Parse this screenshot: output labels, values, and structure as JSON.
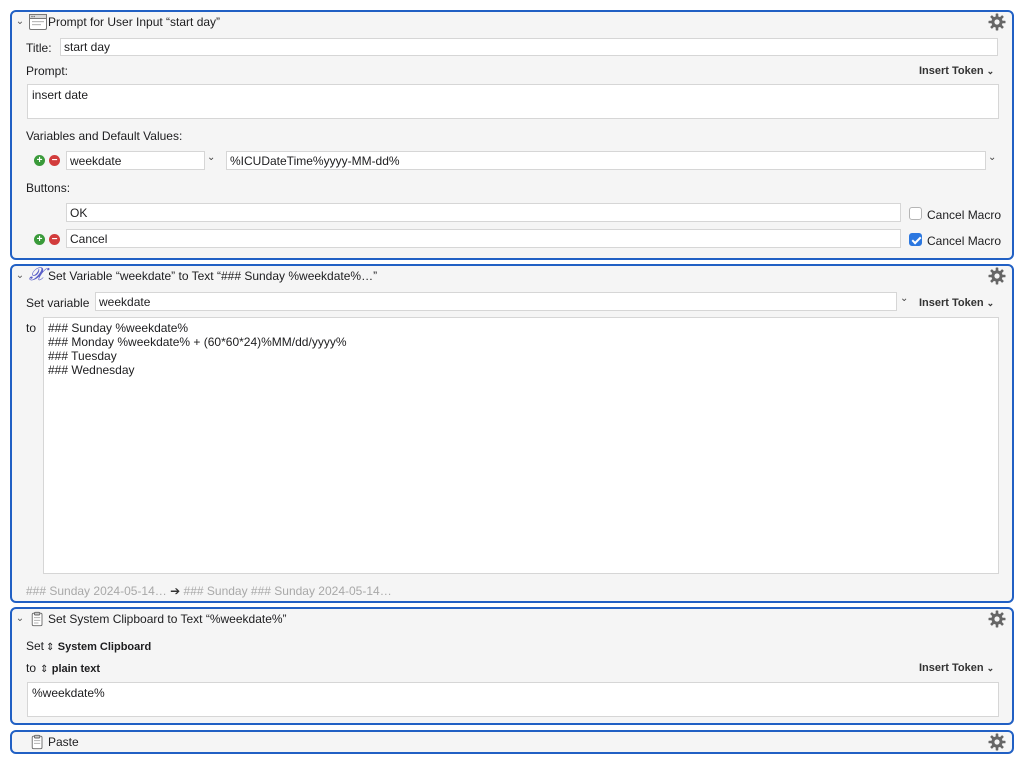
{
  "prompt_action": {
    "title": "Prompt for User Input “start day”",
    "title_label": "Title:",
    "title_value": "start day",
    "prompt_label": "Prompt:",
    "prompt_value": "insert date",
    "insert_token": "Insert Token",
    "variables_label": "Variables and Default Values:",
    "variable_name": "weekdate",
    "variable_default": "%ICUDateTime%yyyy-MM-dd%",
    "buttons_label": "Buttons:",
    "buttons": [
      {
        "name": "OK",
        "cancel_macro_label": "Cancel Macro",
        "cancel_macro": false
      },
      {
        "name": "Cancel",
        "cancel_macro_label": "Cancel Macro",
        "cancel_macro": true
      }
    ]
  },
  "setvar_action": {
    "title": "Set Variable “weekdate” to Text “### Sunday %weekdate%…”",
    "set_variable_label": "Set variable",
    "variable": "weekdate",
    "insert_token": "Insert Token",
    "to_label": "to",
    "text_value": "### Sunday %weekdate%\n### Monday %weekdate% + (60*60*24)%MM/dd/yyyy%\n### Tuesday\n### Wednesday",
    "preview_left": "### Sunday 2024-05-14…",
    "preview_arrow": "➔",
    "preview_right": "### Sunday ### Sunday 2024-05-14…"
  },
  "clipboard_action": {
    "title": "Set System Clipboard to Text “%weekdate%”",
    "set_label": "Set",
    "clipboard": "System Clipboard",
    "to_label": "to",
    "format": "plain text",
    "insert_token": "Insert Token",
    "text_value": "%weekdate%"
  },
  "paste_action": {
    "title": "Paste"
  },
  "icons": {
    "collapse": "chevron-down-icon",
    "settings": "gear-icon",
    "prompt": "window-icon",
    "variable": "variable-x-icon",
    "clipboard": "clipboard-icon"
  },
  "colors": {
    "selection_border": "#2160c4",
    "panel_bg": "#f5f5f5",
    "plus": "#3a9a3a",
    "minus": "#d23c3c",
    "checkbox_checked": "#2b77e0"
  }
}
